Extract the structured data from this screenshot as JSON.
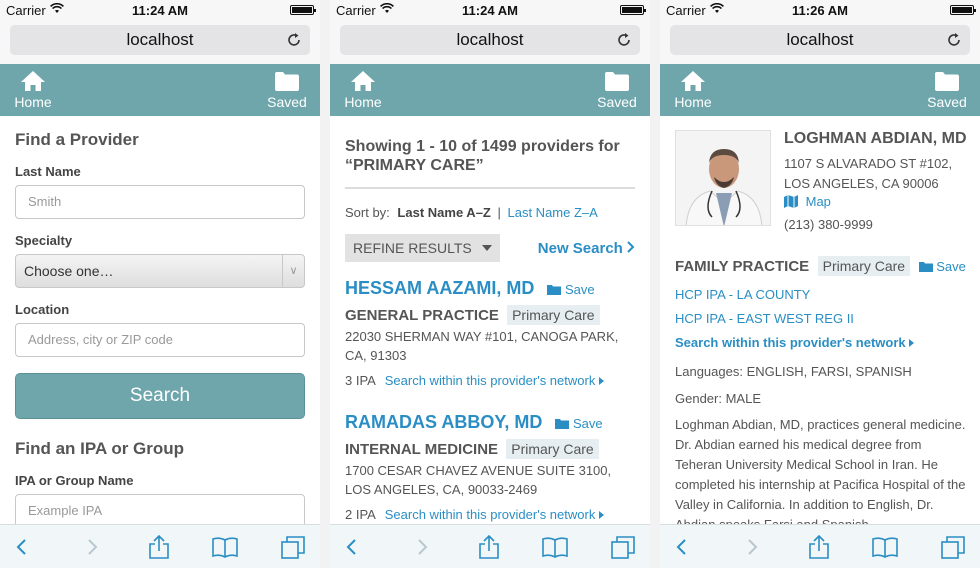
{
  "screens": [
    {
      "carrier": "Carrier",
      "time": "11:24 AM",
      "url": "localhost"
    },
    {
      "carrier": "Carrier",
      "time": "11:24 AM",
      "url": "localhost"
    },
    {
      "carrier": "Carrier",
      "time": "11:26 AM",
      "url": "localhost"
    }
  ],
  "nav": {
    "home_label": "Home",
    "saved_label": "Saved"
  },
  "colors": {
    "accent": "#6ea6ab",
    "link": "#2a8ec4",
    "tag_bg": "#e6eef2"
  },
  "find_provider": {
    "title": "Find a Provider",
    "last_name_label": "Last Name",
    "last_name_placeholder": "Smith",
    "specialty_label": "Specialty",
    "specialty_value": "Choose one…",
    "location_label": "Location",
    "location_placeholder": "Address, city or ZIP code",
    "search_button": "Search",
    "ipa_title": "Find an IPA or Group",
    "ipa_label": "IPA or Group Name",
    "ipa_placeholder": "Example IPA"
  },
  "results": {
    "heading": "Showing 1 - 10 of 1499 providers for “PRIMARY CARE”",
    "sort_by_label": "Sort by:",
    "sort_active": "Last Name A–Z",
    "sort_separator": "|",
    "sort_other": "Last Name Z–A",
    "refine_label": "REFINE RESULTS",
    "new_search_label": "New Search",
    "save_label": "Save",
    "providers": [
      {
        "name": "HESSAM AAZAMI, MD",
        "specialty": "GENERAL PRACTICE",
        "tag": "Primary Care",
        "address": "22030 SHERMAN WAY #101, CANOGA PARK, CA, 91303",
        "ipa_count": "3 IPA",
        "network_link": "Search within this provider's network"
      },
      {
        "name": "RAMADAS ABBOY, MD",
        "specialty": "INTERNAL MEDICINE",
        "tag": "Primary Care",
        "address": "1700 CESAR CHAVEZ AVENUE SUITE 3100, LOS ANGELES, CA, 90033-2469",
        "ipa_count": "2 IPA",
        "network_link": "Search within this provider's network"
      }
    ]
  },
  "detail": {
    "name": "LOGHMAN ABDIAN, MD",
    "address_line1": "1107 S ALVARADO ST #102,",
    "address_line2": "LOS ANGELES, CA 90006",
    "map_label": "Map",
    "phone": "(213) 380-9999",
    "specialty": "FAMILY PRACTICE",
    "tag": "Primary Care",
    "save_label": "Save",
    "ipa_links": [
      "HCP IPA - LA COUNTY",
      "HCP IPA - EAST WEST REG II"
    ],
    "network_link": "Search within this provider's network",
    "languages": "Languages: ENGLISH, FARSI, SPANISH",
    "gender": "Gender: MALE",
    "bio": "Loghman Abdian, MD, practices general medicine. Dr. Abdian earned his medical degree from Teheran University Medical School in Iran. He completed his internship at Pacifica Hospital of the Valley in California. In addition to English, Dr. Abdian speaks Farsi and Spanish."
  }
}
